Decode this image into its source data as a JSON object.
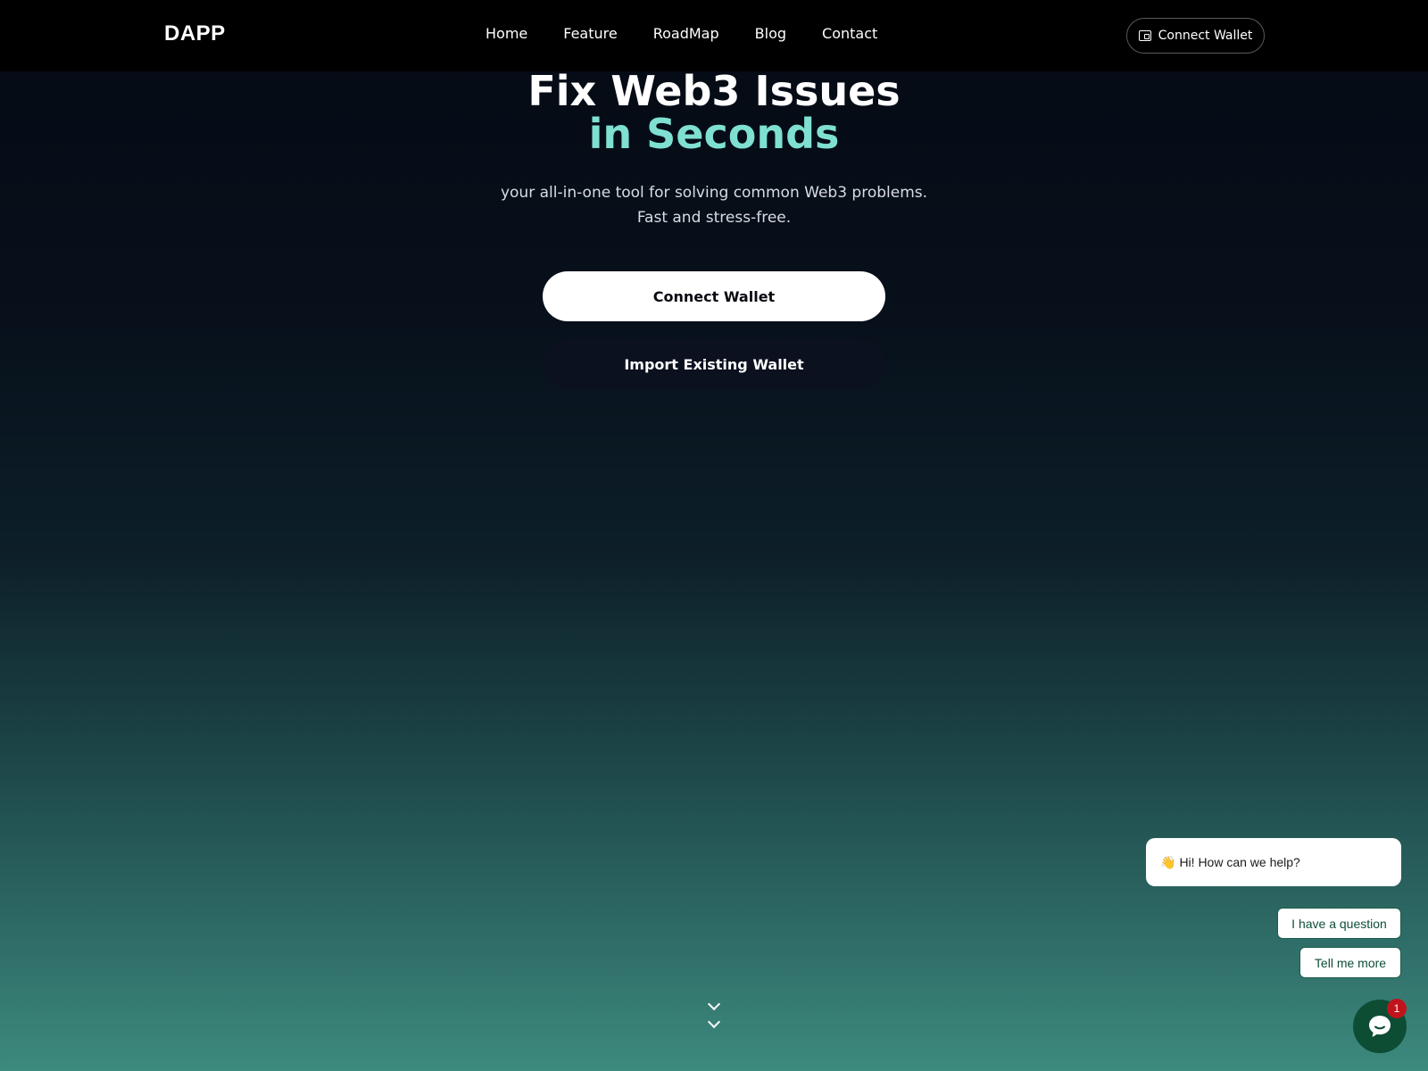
{
  "navbar": {
    "brand": "DAPP",
    "links": [
      "Home",
      "Feature",
      "RoadMap",
      "Blog",
      "Contact"
    ],
    "connect_label": "Connect Wallet"
  },
  "hero": {
    "title_line1": "Fix Web3 Issues",
    "title_line2": "in Seconds",
    "subtitle_line1": "your all-in-one tool for solving common Web3 problems.",
    "subtitle_line2": "Fast and stress-free.",
    "primary_button": "Connect Wallet",
    "secondary_button": "Import Existing Wallet"
  },
  "chat": {
    "greeting_emoji": "👋",
    "greeting": "Hi! How can we help?",
    "option1": "I have a question",
    "option2": "Tell me more",
    "badge_count": "1"
  },
  "colors": {
    "accent": "#7fe0d2",
    "chat_green": "#0c4d33",
    "badge_red": "#c0141c"
  },
  "icons": {
    "wallet": "wallet-icon",
    "scroll": "chevron-down-icon",
    "chat": "chat-bubble-icon"
  }
}
